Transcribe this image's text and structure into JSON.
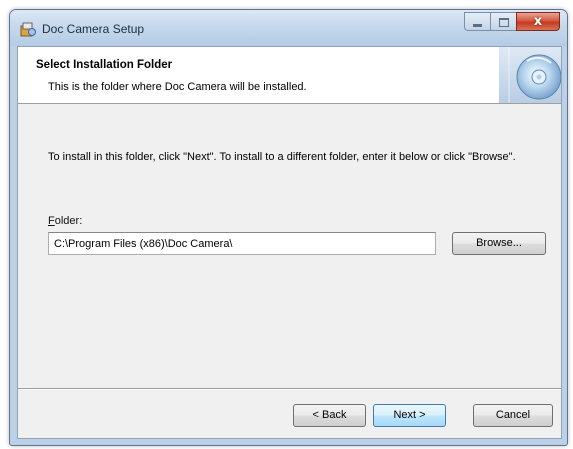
{
  "window": {
    "title": "Doc Camera Setup",
    "close_glyph": "x"
  },
  "banner": {
    "title": "Select Installation Folder",
    "subtitle": "This is the folder where Doc Camera will be installed.",
    "art_icon": "cd-disc-icon"
  },
  "main": {
    "instructions": "To install in this folder, click \"Next\". To install to a different folder, enter it below or click \"Browse\".",
    "folder_label_accel": "F",
    "folder_label_rest": "older:",
    "folder_value": "C:\\Program Files (x86)\\Doc Camera\\",
    "browse_label": "Browse..."
  },
  "footer": {
    "back_label": "< Back",
    "next_label": "Next >",
    "cancel_label": "Cancel"
  },
  "colors": {
    "title_bar": "#c4d7ec",
    "close_button": "#c43b1f",
    "client_bg": "#f0f0f0",
    "default_button_border": "#3c7fb1"
  }
}
